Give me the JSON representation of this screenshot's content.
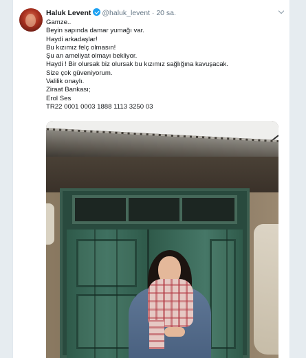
{
  "tweet": {
    "author_name": "Haluk Levent",
    "handle": "@haluk_levent",
    "separator": "·",
    "time": "20 sa.",
    "lines": [
      "Gamze..",
      "Beyin sapında damar yumağı var.",
      "Haydi arkadaşlar!",
      "Bu kızımız felç olmasın!",
      "Şu an ameliyat olmayı bekliyor.",
      "Haydi ! Bir olursak biz olursak bu kızımız sağlığına kavuşacak.",
      "Size çok güveniyorum.",
      "Valilik onaylı.",
      "Ziraat Bankası;",
      "Erol Ses",
      "TR22 0001 0003 1888 1113 3250 03"
    ]
  },
  "icons": {
    "verified": "verified-badge-icon",
    "menu": "chevron-down-icon"
  },
  "colors": {
    "background": "#e6ecf0",
    "card": "#ffffff",
    "text": "#14171a",
    "muted": "#657786",
    "verified": "#1da1f2"
  }
}
